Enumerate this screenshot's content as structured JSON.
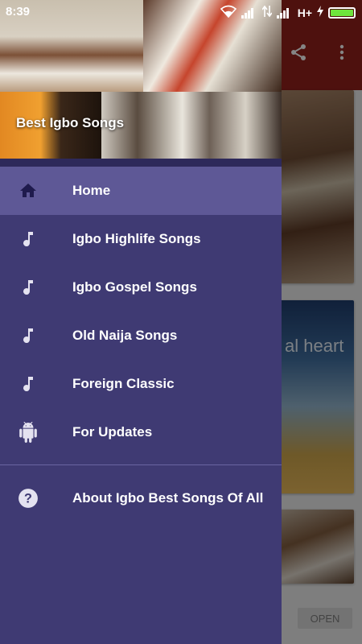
{
  "status_bar": {
    "time": "8:39",
    "network": "H+",
    "icons": [
      "wifi-icon",
      "signal-icon",
      "data-arrows-icon",
      "signal-icon",
      "charging-icon",
      "battery-icon"
    ],
    "battery_color": "#6ee43c"
  },
  "background_app": {
    "toolbar_color": "#8e1f1b",
    "actions": [
      "share-icon",
      "more-vert-icon"
    ],
    "card_text": "al heart",
    "open_button_label": "OPEN"
  },
  "drawer": {
    "background_color": "#3f3a73",
    "active_color": "#5e5896",
    "header_title": "Best Igbo Songs",
    "items": [
      {
        "label": "Home",
        "icon": "home-icon",
        "active": true
      },
      {
        "label": "Igbo Highlife Songs",
        "icon": "music-note-icon"
      },
      {
        "label": "Igbo Gospel Songs",
        "icon": "music-note-icon"
      },
      {
        "label": "Old Naija Songs",
        "icon": "music-note-icon"
      },
      {
        "label": "Foreign Classic",
        "icon": "music-note-icon"
      },
      {
        "label": "For Updates",
        "icon": "android-icon"
      }
    ],
    "about": {
      "label": "About Igbo Best Songs Of All",
      "icon": "help-icon"
    }
  }
}
